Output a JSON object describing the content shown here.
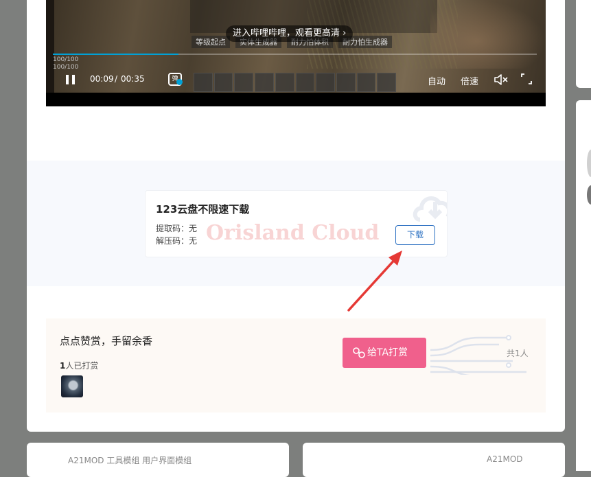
{
  "video": {
    "enter_toast": "进入哔哩哔哩，观看更高清 ›",
    "hud_labels": [
      "等级起点",
      "实体生成器",
      "耐力怕体积",
      "耐力怕生成器"
    ],
    "hud_small_lines": [
      "100/100",
      "100/100"
    ],
    "time_current": "00:09",
    "time_separator": "/",
    "time_total": "00:35",
    "progress": 0.26,
    "danmaku_label": "弹",
    "quality_label": "自动",
    "speed_label": "倍速"
  },
  "download": {
    "title": "123云盘不限速下载",
    "extract_code": "提取码：无",
    "unzip_code": "解压码：无",
    "watermark": "Orisland Cloud",
    "button_label": "下载"
  },
  "reward": {
    "title": "点点赞赏，手留余香",
    "count_number": "1",
    "count_suffix": "人已打赏",
    "button_label": "给TA打赏",
    "total": "共1人"
  },
  "bottom_cards": [
    {
      "text": "A21MOD  工具模组  用户界面模组"
    },
    {
      "text": "A21MOD"
    }
  ],
  "colors": {
    "page_bg": "#7d7f7d",
    "accent_blue": "#2a6fc1",
    "tip_pink": "#f0608c",
    "bili_blue": "#00a1d6",
    "arrow_red": "#e53935"
  }
}
